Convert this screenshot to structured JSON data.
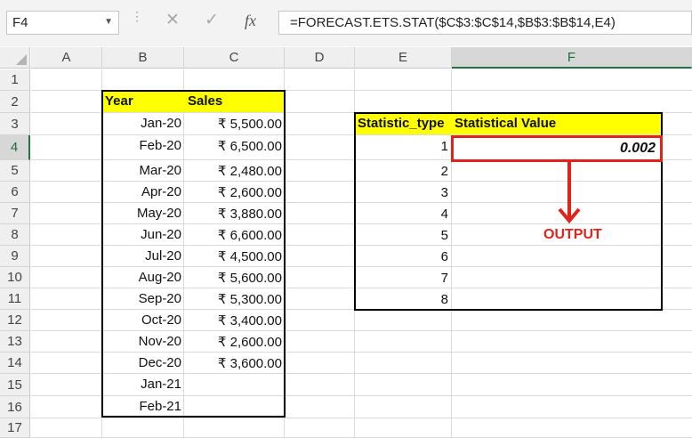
{
  "formula_bar": {
    "name_box": "F4",
    "cancel_glyph": "✕",
    "enter_glyph": "✓",
    "fx_label": "fx",
    "formula": "=FORECAST.ETS.STAT($C$3:$C$14,$B$3:$B$14,E4)"
  },
  "columns": [
    "A",
    "B",
    "C",
    "D",
    "E",
    "F"
  ],
  "rows": [
    "1",
    "2",
    "3",
    "4",
    "5",
    "6",
    "7",
    "8",
    "9",
    "10",
    "11",
    "12",
    "13",
    "14",
    "15",
    "16",
    "17"
  ],
  "table1": {
    "header_year": "Year",
    "header_sales": "Sales",
    "rows": [
      {
        "year": "Jan-20",
        "sales": "₹ 5,500.00"
      },
      {
        "year": "Feb-20",
        "sales": "₹ 6,500.00"
      },
      {
        "year": "Mar-20",
        "sales": "₹ 2,480.00"
      },
      {
        "year": "Apr-20",
        "sales": "₹ 2,600.00"
      },
      {
        "year": "May-20",
        "sales": "₹ 3,880.00"
      },
      {
        "year": "Jun-20",
        "sales": "₹ 6,600.00"
      },
      {
        "year": "Jul-20",
        "sales": "₹ 4,500.00"
      },
      {
        "year": "Aug-20",
        "sales": "₹ 5,600.00"
      },
      {
        "year": "Sep-20",
        "sales": "₹ 5,300.00"
      },
      {
        "year": "Oct-20",
        "sales": "₹ 3,400.00"
      },
      {
        "year": "Nov-20",
        "sales": "₹ 2,600.00"
      },
      {
        "year": "Dec-20",
        "sales": "₹ 3,600.00"
      },
      {
        "year": "Jan-21",
        "sales": ""
      },
      {
        "year": "Feb-21",
        "sales": ""
      }
    ]
  },
  "table2": {
    "header_type": "Statistic_type",
    "header_value": "Statistical Value",
    "types": [
      "1",
      "2",
      "3",
      "4",
      "5",
      "6",
      "7",
      "8"
    ],
    "result": "0.002"
  },
  "annotation": {
    "label": "OUTPUT",
    "color": "#e0241b"
  },
  "colors": {
    "header_fill": "#ffff00",
    "selection_green": "#217346"
  }
}
